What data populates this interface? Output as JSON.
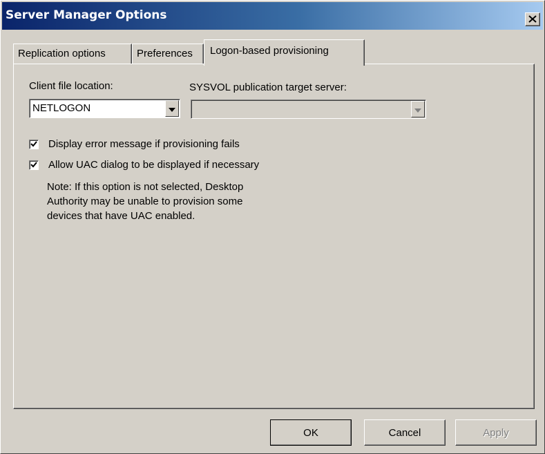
{
  "window": {
    "title": "Server Manager Options",
    "close_icon": "close-x-icon"
  },
  "tabs": [
    {
      "label": "Replication options",
      "active": false
    },
    {
      "label": "Preferences",
      "active": false
    },
    {
      "label": "Logon-based provisioning",
      "active": true
    }
  ],
  "panel": {
    "client_file_location": {
      "label": "Client file location:",
      "value": "NETLOGON",
      "enabled": true
    },
    "sysvol_target": {
      "label": "SYSVOL publication target server:",
      "value": "",
      "enabled": false
    },
    "checkboxes": [
      {
        "label": "Display error message if provisioning fails",
        "checked": true
      },
      {
        "label": "Allow UAC dialog to be displayed if necessary",
        "checked": true
      }
    ],
    "note": "Note: If this option is not selected, Desktop\nAuthority may be unable to provision some\ndevices that have UAC enabled."
  },
  "buttons": {
    "ok": "OK",
    "cancel": "Cancel",
    "apply": "Apply"
  },
  "colors": {
    "titlebar_start": "#0a246a",
    "titlebar_end": "#a6caf0",
    "face": "#d4d0c8"
  }
}
